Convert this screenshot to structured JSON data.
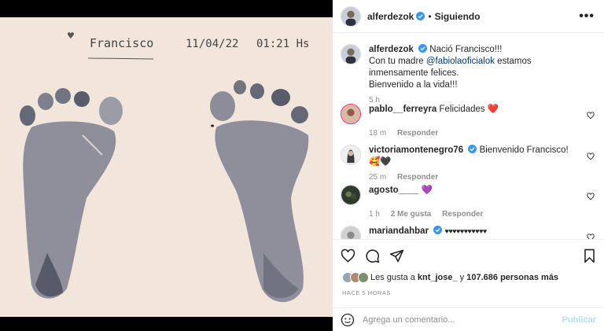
{
  "photo": {
    "name": "Francisco",
    "date": "11/04/22",
    "time": "01:21 Hs"
  },
  "post": {
    "username": "alferdezok",
    "separator": "•",
    "follow_label": "Siguiendo",
    "more_label": "•••",
    "caption_line1": "Nació Francisco!!!",
    "caption_line2_pre": "Con tu madre ",
    "caption_mention": "@fabiolaoficialok",
    "caption_line2_post": " estamos inmensamente felices.",
    "caption_line3": "Bienvenido a la vida!!!",
    "caption_time": "5 h"
  },
  "comments": [
    {
      "user": "pablo__ferreyra",
      "text": "Felicidades",
      "emoji": "❤️",
      "time": "18 m",
      "likes": "",
      "reply": "Responder"
    },
    {
      "user": "victoriamontenegro76",
      "text": "Bienvenido Francisco!",
      "emoji": "🥰🖤",
      "time": "25 m",
      "likes": "",
      "reply": "Responder"
    },
    {
      "user": "agosto____",
      "text": "",
      "emoji": "💜",
      "time": "1 h",
      "likes": "2 Me gusta",
      "reply": "Responder"
    },
    {
      "user": "mariandahbar",
      "text": "",
      "emoji": "♥♥♥♥♥♥♥♥♥♥♥",
      "time": "",
      "likes": "",
      "reply": ""
    }
  ],
  "likes": {
    "prefix": "Les gusta a ",
    "user": "knt_jose_",
    "middle": " y ",
    "count": "107.686 personas más"
  },
  "timestamp": "Hace 5 horas",
  "add_comment": {
    "placeholder": "Agrega un comentario...",
    "publish": "Publicar"
  },
  "colors": {
    "accent": "#0095f6",
    "mention": "#00376b",
    "like_red": "#ed4956",
    "verified": "#3897f0"
  }
}
